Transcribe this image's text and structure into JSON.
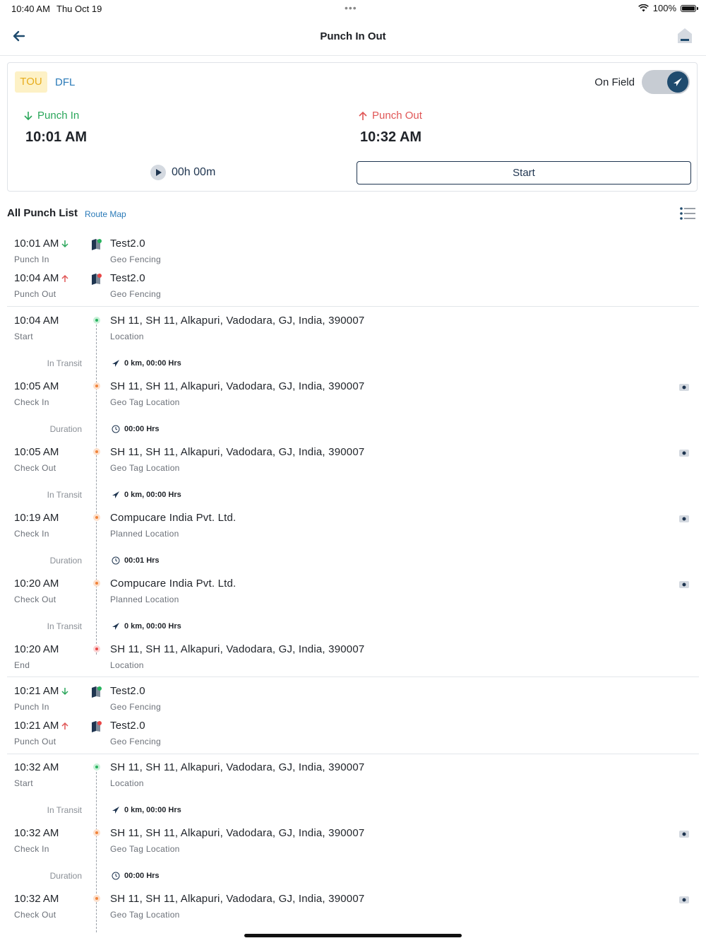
{
  "status_bar": {
    "time": "10:40 AM",
    "date": "Thu Oct 19",
    "battery": "100%"
  },
  "nav": {
    "title": "Punch In Out"
  },
  "card": {
    "tag_primary": "TOU",
    "tag_secondary": "DFL",
    "on_field_label": "On Field",
    "punch_in_label": "Punch In",
    "punch_in_time": "10:01 AM",
    "punch_out_label": "Punch Out",
    "punch_out_time": "10:32 AM",
    "timer": "00h 00m",
    "start_label": "Start"
  },
  "list": {
    "title": "All Punch List",
    "route_map": "Route Map"
  },
  "entries": [
    {
      "time": "10:01 AM",
      "sub": "Punch In",
      "title": "Test2.0",
      "title_sub": "Geo Fencing"
    },
    {
      "time": "10:04 AM",
      "sub": "Punch Out",
      "title": "Test2.0",
      "title_sub": "Geo Fencing"
    },
    {
      "time": "10:04 AM",
      "sub": "Start",
      "title": "SH 11, SH 11, Alkapuri, Vadodara, GJ, India, 390007",
      "title_sub": "Location"
    },
    {
      "mid_label": "In Transit",
      "mid_val": "0 km, 00:00 Hrs"
    },
    {
      "time": "10:05 AM",
      "sub": "Check In",
      "title": "SH 11, SH 11, Alkapuri, Vadodara, GJ, India, 390007",
      "title_sub": "Geo Tag Location"
    },
    {
      "mid_label": "Duration",
      "mid_val": "00:00 Hrs"
    },
    {
      "time": "10:05 AM",
      "sub": "Check Out",
      "title": "SH 11, SH 11, Alkapuri, Vadodara, GJ, India, 390007",
      "title_sub": "Geo Tag Location"
    },
    {
      "mid_label": "In Transit",
      "mid_val": "0 km, 00:00 Hrs"
    },
    {
      "time": "10:19 AM",
      "sub": "Check In",
      "title": "Compucare India Pvt. Ltd.",
      "title_sub": "Planned Location"
    },
    {
      "mid_label": "Duration",
      "mid_val": "00:01 Hrs"
    },
    {
      "time": "10:20 AM",
      "sub": "Check Out",
      "title": "Compucare India Pvt. Ltd.",
      "title_sub": "Planned Location"
    },
    {
      "mid_label": "In Transit",
      "mid_val": "0 km, 00:00 Hrs"
    },
    {
      "time": "10:20 AM",
      "sub": "End",
      "title": "SH 11, SH 11, Alkapuri, Vadodara, GJ, India, 390007",
      "title_sub": "Location"
    },
    {
      "time": "10:21 AM",
      "sub": "Punch In",
      "title": "Test2.0",
      "title_sub": "Geo Fencing"
    },
    {
      "time": "10:21 AM",
      "sub": "Punch Out",
      "title": "Test2.0",
      "title_sub": "Geo Fencing"
    },
    {
      "time": "10:32 AM",
      "sub": "Start",
      "title": "SH 11, SH 11, Alkapuri, Vadodara, GJ, India, 390007",
      "title_sub": "Location"
    },
    {
      "mid_label": "In Transit",
      "mid_val": "0 km, 00:00 Hrs"
    },
    {
      "time": "10:32 AM",
      "sub": "Check In",
      "title": "SH 11, SH 11, Alkapuri, Vadodara, GJ, India, 390007",
      "title_sub": "Geo Tag Location"
    },
    {
      "mid_label": "Duration",
      "mid_val": "00:00 Hrs"
    },
    {
      "time": "10:32 AM",
      "sub": "Check Out",
      "title": "SH 11, SH 11, Alkapuri, Vadodara, GJ, India, 390007",
      "title_sub": "Geo Tag Location"
    }
  ],
  "colors": {
    "accent": "#1f4b6e",
    "punch_in": "#2aa65a",
    "punch_out": "#e05656",
    "link": "#2a7ab8",
    "tag_bg": "#fdf1c6",
    "tag_fg": "#e7ad1d"
  },
  "icons": [
    "back-arrow-icon",
    "home-icon",
    "navigation-arrow-icon",
    "arrow-down-icon",
    "arrow-up-icon",
    "play-icon",
    "list-menu-icon",
    "geo-fence-icon",
    "camera-icon",
    "clock-icon",
    "location-dot-icon"
  ]
}
